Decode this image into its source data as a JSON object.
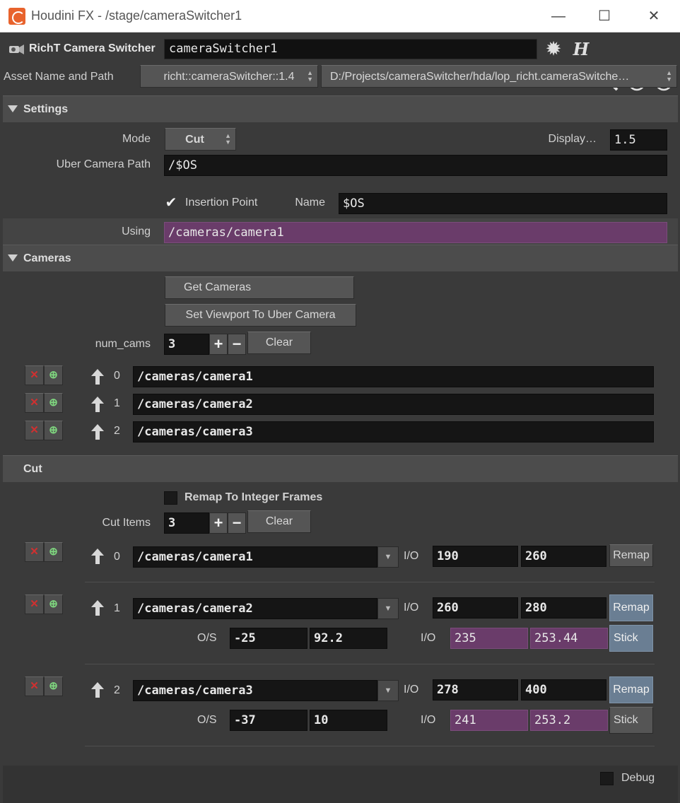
{
  "window": {
    "title": "Houdini FX - /stage/cameraSwitcher1",
    "minimize": "—",
    "maximize": "☐",
    "close": "✕"
  },
  "header": {
    "node_type": "RichT Camera Switcher",
    "node_name": "cameraSwitcher1",
    "icons": [
      "gear-icon",
      "houdini-h-icon",
      "search-icon",
      "info-icon",
      "help-icon"
    ]
  },
  "asset": {
    "label": "Asset Name and Path",
    "name": "richt::cameraSwitcher::1.4",
    "path": "D:/Projects/cameraSwitcher/hda/lop_richt.cameraSwitche…"
  },
  "settings": {
    "folder_label": "Settings",
    "mode_label": "Mode",
    "mode_value": "Cut",
    "display_label": "Display…",
    "display_value": "1.5",
    "uber_label": "Uber Camera Path",
    "uber_value": "/$OS",
    "insertion_label": "Insertion Point",
    "insertion_checked": true,
    "name_label": "Name",
    "name_value": "$OS",
    "using_label": "Using",
    "using_value": "/cameras/camera1"
  },
  "cameras": {
    "folder_label": "Cameras",
    "get_cameras": "Get Cameras",
    "set_viewport": "Set Viewport To Uber Camera",
    "num_label": "num_cams",
    "num_value": "3",
    "plus": "+",
    "minus": "−",
    "clear": "Clear",
    "items": [
      {
        "index": "0",
        "path": "/cameras/camera1"
      },
      {
        "index": "1",
        "path": "/cameras/camera2"
      },
      {
        "index": "2",
        "path": "/cameras/camera3"
      }
    ]
  },
  "cut": {
    "folder_label": "Cut",
    "remap_label": "Remap To Integer Frames",
    "items_label": "Cut Items",
    "items_value": "3",
    "plus": "+",
    "minus": "−",
    "clear": "Clear",
    "io_label": "I/O",
    "os_label": "O/S",
    "items": [
      {
        "index": "0",
        "path": "/cameras/camera1",
        "in": "190",
        "out": "260",
        "remap": "Remap",
        "remap_active": false
      },
      {
        "index": "1",
        "path": "/cameras/camera2",
        "in": "260",
        "out": "280",
        "remap": "Remap",
        "remap_active": true,
        "os_a": "-25",
        "os_b": "92.2",
        "io_a": "235",
        "io_b": "253.44",
        "stick": "Stick",
        "stick_active": true
      },
      {
        "index": "2",
        "path": "/cameras/camera3",
        "in": "278",
        "out": "400",
        "remap": "Remap",
        "remap_active": true,
        "os_a": "-37",
        "os_b": "10",
        "io_a": "241",
        "io_b": "253.2",
        "stick": "Stick",
        "stick_active": false
      }
    ]
  },
  "debug": {
    "label": "Debug",
    "checked": false
  },
  "colors": {
    "background": "#3a3a3a",
    "field": "#151515",
    "purple_field": "#6a3c6a",
    "active_button": "#6a7e93",
    "accent_orange": "#e8632d"
  }
}
